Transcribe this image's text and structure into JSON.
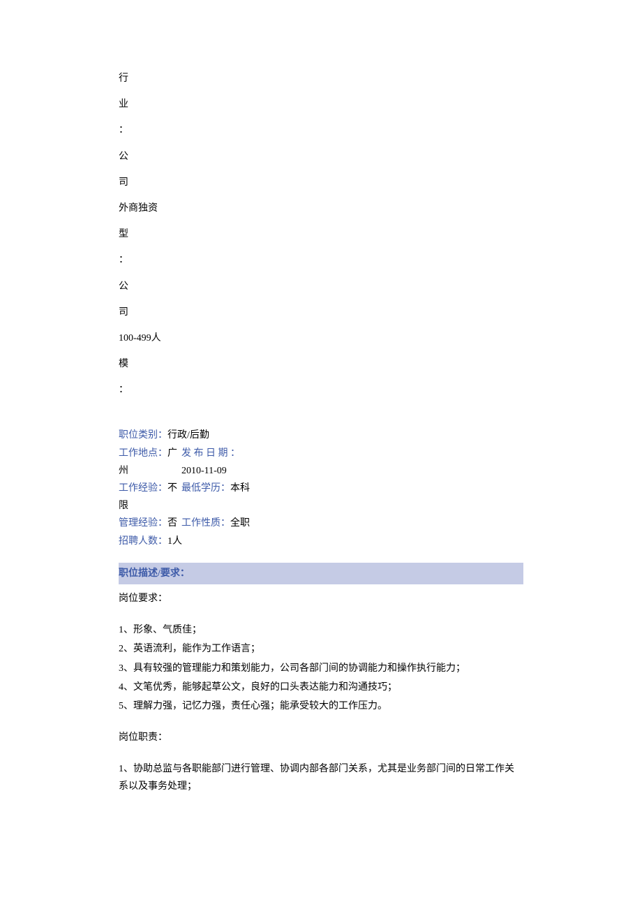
{
  "vertical_text": {
    "c1": "行",
    "c2": "业",
    "c3": "：",
    "c4": "公",
    "c5": "司",
    "c6": "外商独资",
    "c7": "型",
    "c8": "：",
    "c9": "公",
    "c10": "司",
    "c11": "100-499人",
    "c12": "模",
    "c13": "："
  },
  "job": {
    "category_label": "职位类别：",
    "category_value": "行政/后勤",
    "location_label": "工作地点：",
    "location_value": "广州",
    "publish_label": "发 布 日 期 ：",
    "publish_value": "2010-11-09",
    "experience_label": "工作经验：",
    "experience_value": "不限",
    "education_label": "最低学历：",
    "education_value": "本科",
    "management_label": "管理经验：",
    "management_value": "否",
    "nature_label": "工作性质：",
    "nature_value": "全职",
    "hire_count_label": "招聘人数：",
    "hire_count_value": "1人"
  },
  "section_header": "职位描述/要求：",
  "requirements_title": "岗位要求：",
  "requirements": [
    "1、形象、气质佳；",
    "2、英语流利，能作为工作语言；",
    "3、具有较强的管理能力和策划能力，公司各部门间的协调能力和操作执行能力；",
    "4、文笔优秀，能够起草公文，良好的口头表达能力和沟通技巧；",
    "5、理解力强，记忆力强，责任心强；能承受较大的工作压力。"
  ],
  "responsibilities_title": "岗位职责：",
  "responsibilities": [
    "1、协助总监与各职能部门进行管理、协调内部各部门关系，尤其是业务部门间的日常工作关系以及事务处理；"
  ]
}
